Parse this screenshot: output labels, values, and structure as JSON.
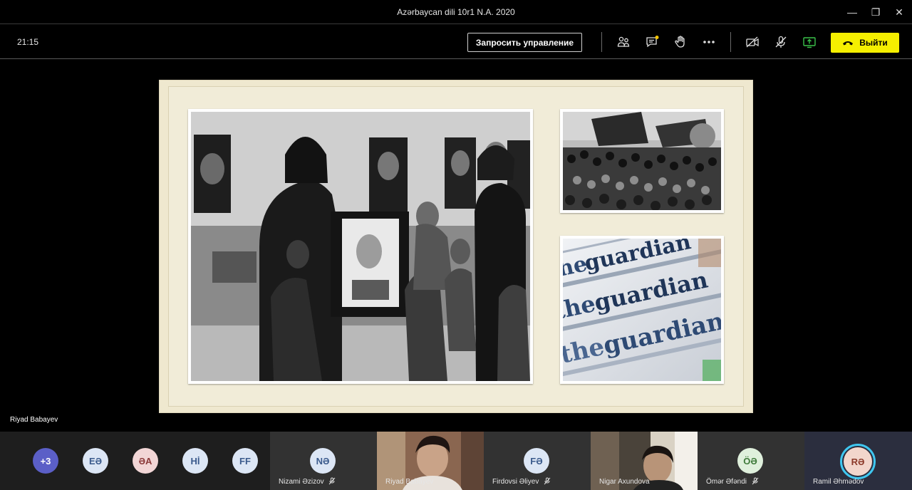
{
  "window": {
    "title": "Azərbaycan dili 10r1 N.A. 2020",
    "minimize_glyph": "—",
    "restore_glyph": "❐",
    "close_glyph": "✕"
  },
  "toolbar": {
    "timer": "21:15",
    "request_control_label": "Запросить управление",
    "leave_label": "Выйти",
    "icons": [
      "participants-icon",
      "chat-icon",
      "raise-hand-icon",
      "more-options-icon",
      "camera-off-icon",
      "mic-off-icon",
      "share-screen-icon",
      "hang-up-icon"
    ],
    "colors": {
      "leave_bg": "#f5ef00",
      "share_green": "#3ac24a",
      "chat_badge": "#f5c400"
    }
  },
  "stage": {
    "presenter_name": "Riyad Babayev"
  },
  "participants": {
    "overflow": {
      "initials": "+3",
      "color": "#5b5fc7"
    },
    "avatars": [
      {
        "initials": "EƏ",
        "color": "#dce6f5",
        "text_color": "#3a5a8c"
      },
      {
        "initials": "ƏA",
        "color": "#f2d6d6",
        "text_color": "#8c3a3a"
      },
      {
        "initials": "Hİ",
        "color": "#dce6f5",
        "text_color": "#3a5a8c"
      },
      {
        "initials": "FF",
        "color": "#dce6f5",
        "text_color": "#3a5a8c"
      }
    ],
    "tiles": [
      {
        "name": "Nizami Əzizov",
        "initials": "NƏ",
        "type": "avatar",
        "muted": true
      },
      {
        "name": "Riyad Babayev",
        "initials": "",
        "type": "video",
        "muted": false
      },
      {
        "name": "Firdovsi Əliyev",
        "initials": "FƏ",
        "type": "avatar",
        "muted": true
      },
      {
        "name": "Nigar Axundova",
        "initials": "",
        "type": "video",
        "muted": false
      },
      {
        "name": "Ömər Əfəndi",
        "initials": "ÖƏ",
        "type": "avatar",
        "muted": true
      },
      {
        "name": "Ramil Əhmədov",
        "initials": "RƏ",
        "type": "avatar-speaking",
        "muted": false
      }
    ]
  }
}
